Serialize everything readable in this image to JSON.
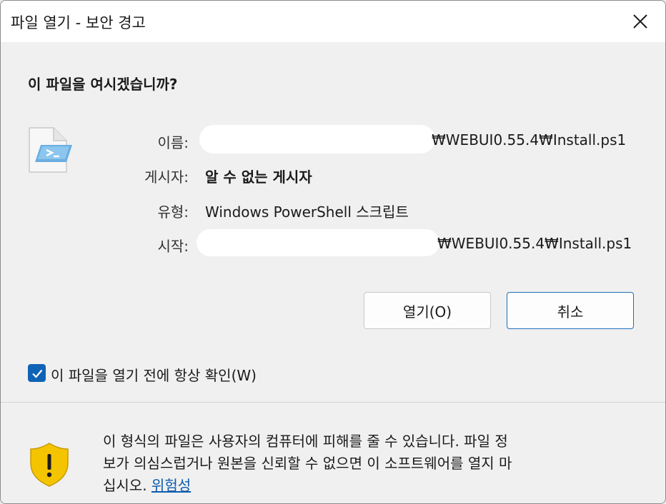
{
  "window": {
    "title": "파일 열기 - 보안 경고"
  },
  "prompt": {
    "heading": "이 파일을 여시겠습니까?"
  },
  "details": {
    "name_label": "이름:",
    "name_value_suffix": "₩WEBUI0.55.4₩Install.ps1",
    "publisher_label": "게시자:",
    "publisher_value": "알 수 없는 게시자",
    "type_label": "유형:",
    "type_value": "Windows PowerShell 스크립트",
    "from_label": "시작:",
    "from_value_suffix": "₩WEBUI0.55.4₩Install.ps1"
  },
  "buttons": {
    "open_label": "열기(O)",
    "cancel_label": "취소"
  },
  "checkbox": {
    "label": "이 파일을 열기 전에 항상 확인(W)",
    "checked": true
  },
  "warning": {
    "line1": "이 형식의 파일은 사용자의 컴퓨터에 피해를 줄 수 있습니다. 파일 정",
    "line2": "보가 의심스럽거나 원본을 신뢰할 수 없으면 이 소프트웨어를 열지 마",
    "line3": "십시오.",
    "link": "위험성"
  },
  "icons": {
    "close": "close-icon",
    "file": "powershell-file-icon",
    "shield": "warning-shield-icon",
    "check": "checkmark-icon"
  },
  "colors": {
    "accent": "#0f63b5",
    "link": "#0b5cad",
    "shield_yellow": "#f5c400"
  }
}
